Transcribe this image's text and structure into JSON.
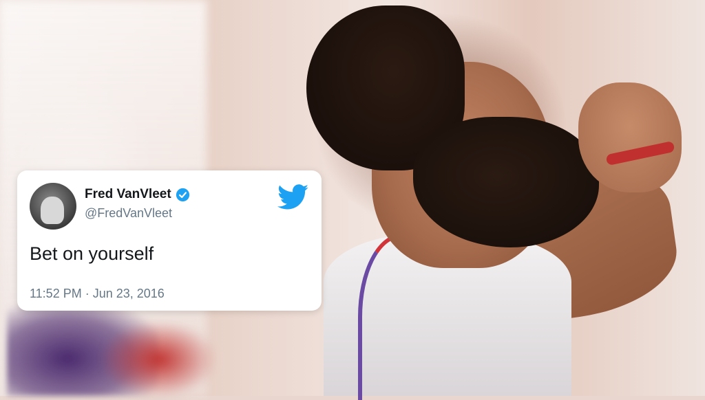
{
  "tweet": {
    "author_name": "Fred VanVleet",
    "handle": "@FredVanVleet",
    "text": "Bet on yourself",
    "timestamp": "11:52 PM · Jun 23, 2016",
    "verified": true,
    "brand_icon": "twitter-bird-icon"
  },
  "colors": {
    "twitter_blue": "#1da1f2",
    "name_text": "#14171a",
    "secondary_text": "#657786",
    "card_bg": "#ffffff"
  }
}
